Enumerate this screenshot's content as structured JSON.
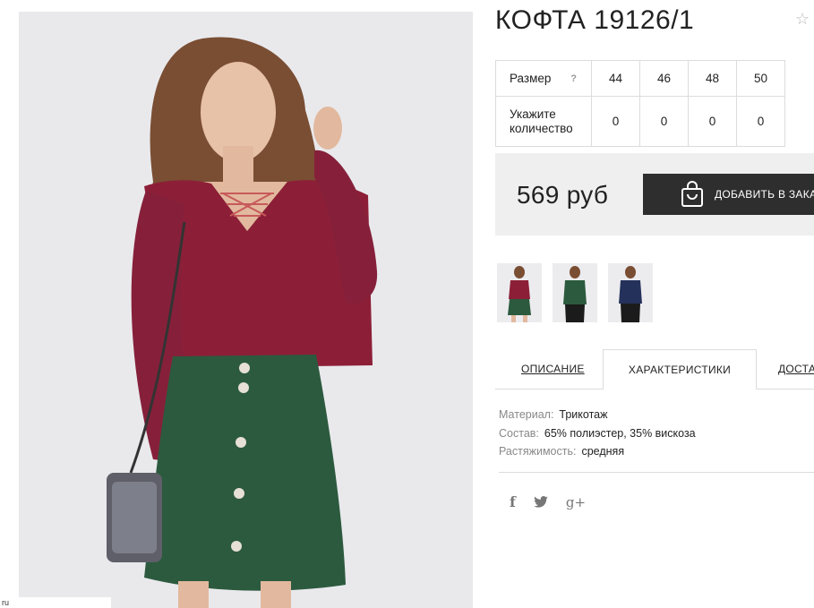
{
  "product": {
    "title": "КОФТА 19126/1",
    "favorite_icon": "star-outline-icon"
  },
  "sizes": {
    "row_size_label": "Размер",
    "help": "?",
    "row_qty_label": "Укажите количество",
    "columns": [
      "44",
      "46",
      "48",
      "50"
    ],
    "quantities": [
      "0",
      "0",
      "0",
      "0"
    ]
  },
  "purchase": {
    "price": "569 руб",
    "add_to_cart": "ДОБАВИТЬ В ЗАКАЗ",
    "cart_icon": "shopping-bag-icon"
  },
  "thumbnails": [
    {
      "name": "burgundy",
      "color": "#8c1f37"
    },
    {
      "name": "green",
      "color": "#2c5a3e"
    },
    {
      "name": "navy",
      "color": "#24315a"
    }
  ],
  "tabs": [
    "ОПИСАНИЕ",
    "ХАРАКТЕРИСТИКИ",
    "ДОСТАВКА"
  ],
  "specs": [
    {
      "key": "Материал:",
      "value": "Трикотаж"
    },
    {
      "key": "Состав:",
      "value": "65% полиэстер, 35% вискоза"
    },
    {
      "key": "Растяжимость:",
      "value": "средняя"
    }
  ],
  "social": {
    "facebook": "f",
    "google": "g+"
  },
  "edge_text": "ru",
  "colors": {
    "button_bg": "#2e2e2e",
    "price_box_bg": "#efefef",
    "sweater": "#8c1f37",
    "skirt": "#2c5a3e"
  }
}
